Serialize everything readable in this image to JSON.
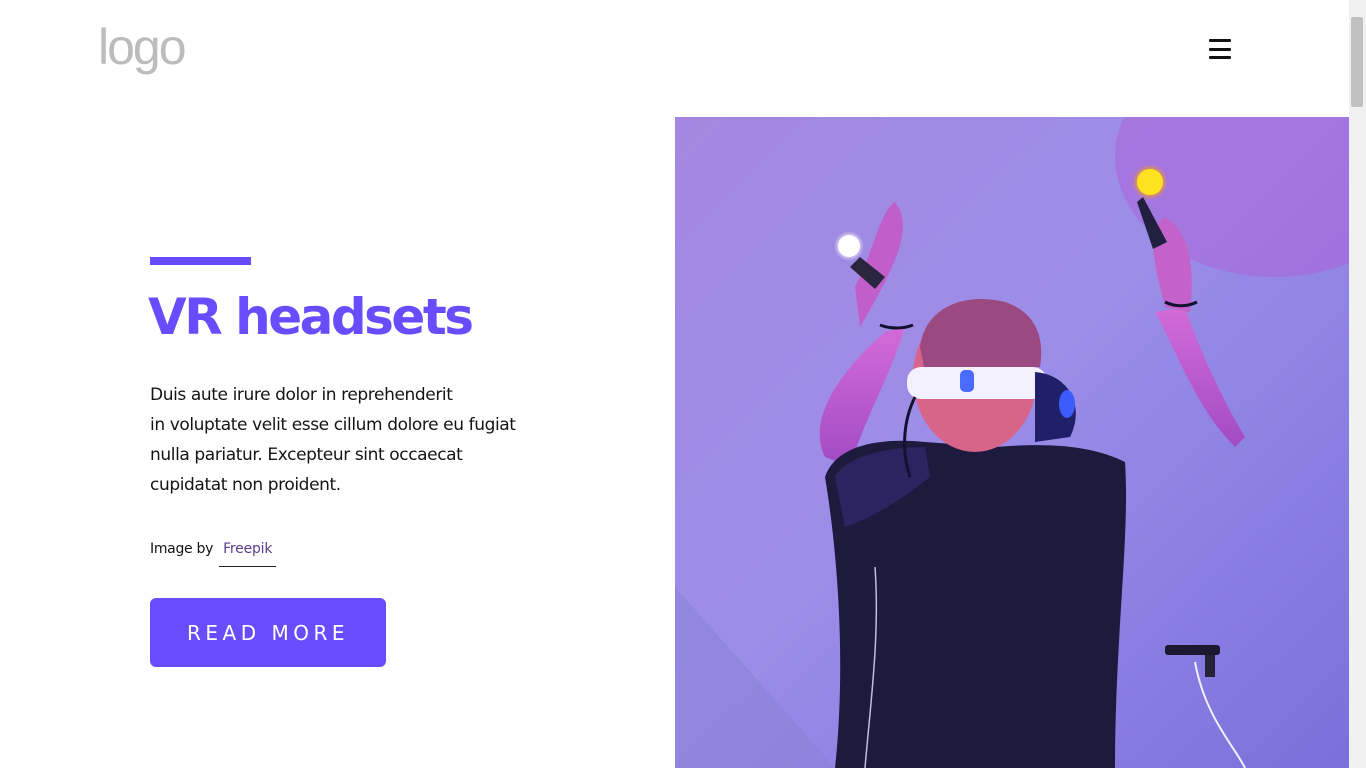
{
  "header": {
    "logo_text": "logo",
    "menu_icon": "hamburger-menu-icon"
  },
  "hero": {
    "title": "VR headsets",
    "description_lines": [
      "Duis aute irure dolor in reprehenderit",
      "in voluptate velit esse cillum dolore eu fugiat",
      "nulla pariatur. Excepteur sint occaecat",
      "cupidatat non proident."
    ],
    "credit_label": "Image by",
    "credit_link": "Freepik",
    "cta_label": "READ MORE"
  },
  "colors": {
    "accent": "#6a4cff",
    "logo": "#bcbcbc",
    "text": "#141414"
  }
}
